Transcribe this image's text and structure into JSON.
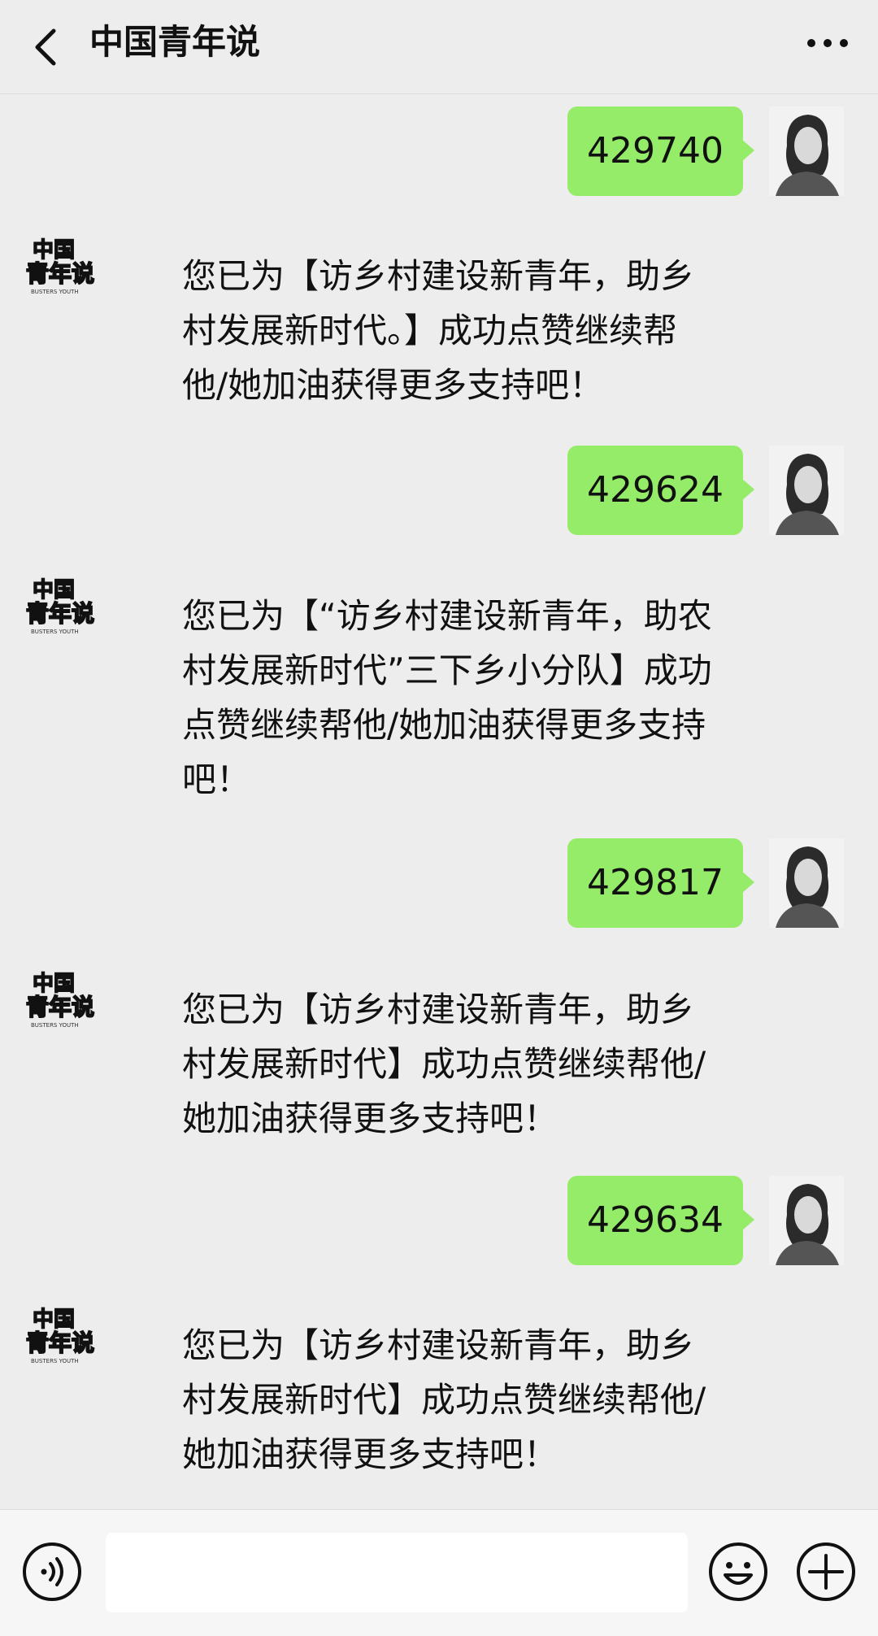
{
  "header": {
    "title": "中国青年说"
  },
  "messages": [
    {
      "dir": "out",
      "text": "429740"
    },
    {
      "dir": "in",
      "text": "您已为【访乡村建设新青年，助乡村发展新时代。】成功点赞继续帮他/她加油获得更多支持吧！"
    },
    {
      "dir": "out",
      "text": "429624"
    },
    {
      "dir": "in",
      "text": "您已为【“访乡村建设新青年，助农村发展新时代”三下乡小分队】成功点赞继续帮他/她加油获得更多支持吧！"
    },
    {
      "dir": "out",
      "text": "429817"
    },
    {
      "dir": "in",
      "text": "您已为【访乡村建设新青年，助乡村发展新时代】成功点赞继续帮他/她加油获得更多支持吧！"
    },
    {
      "dir": "out",
      "text": "429634"
    },
    {
      "dir": "in",
      "text": "您已为【访乡村建设新青年，助乡村发展新时代】成功点赞继续帮他/她加油获得更多支持吧！"
    }
  ],
  "bot_avatar": {
    "line1": "中国",
    "line2": "青年说",
    "sub": "BUSTERS YOUTH"
  },
  "colors": {
    "out_bubble": "#95ec69",
    "background": "#ededed"
  },
  "icons": {
    "back": "back-arrow-icon",
    "more": "more-dots-icon",
    "voice": "voice-icon",
    "emoji": "emoji-icon",
    "plus": "plus-icon"
  }
}
